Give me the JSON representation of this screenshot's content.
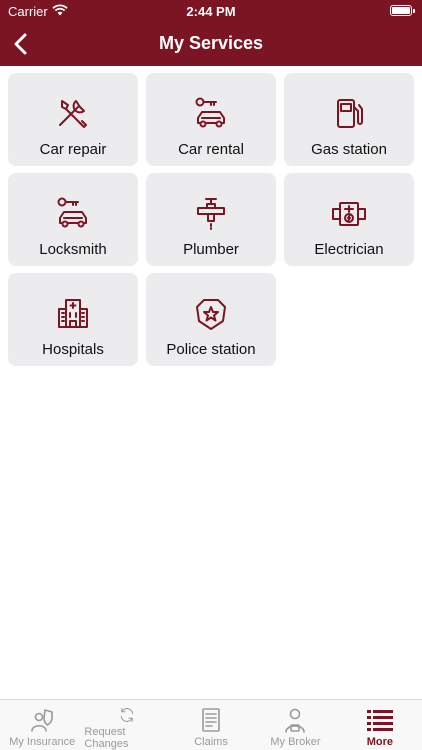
{
  "status": {
    "carrier": "Carrier",
    "time": "2:44 PM"
  },
  "nav": {
    "title": "My Services",
    "back_icon": "chevron-left-icon"
  },
  "services": [
    {
      "label": "Car repair",
      "icon": "tools-icon"
    },
    {
      "label": "Car rental",
      "icon": "car-key-icon"
    },
    {
      "label": "Gas station",
      "icon": "gas-pump-icon"
    },
    {
      "label": "Locksmith",
      "icon": "car-key-icon"
    },
    {
      "label": "Plumber",
      "icon": "faucet-icon"
    },
    {
      "label": "Electrician",
      "icon": "circuit-icon"
    },
    {
      "label": "Hospitals",
      "icon": "hospital-icon"
    },
    {
      "label": "Police station",
      "icon": "police-badge-icon"
    }
  ],
  "tabs": [
    {
      "label": "My Insurance",
      "icon": "shield-person-icon"
    },
    {
      "label": "Request Changes",
      "icon": "refresh-icon"
    },
    {
      "label": "Claims",
      "icon": "document-icon"
    },
    {
      "label": "My Broker",
      "icon": "broker-icon"
    },
    {
      "label": "More",
      "icon": "list-icon"
    }
  ],
  "colors": {
    "brand": "#7c1523",
    "tile_bg": "#ececee",
    "tab_inactive": "#9a9a9a"
  }
}
